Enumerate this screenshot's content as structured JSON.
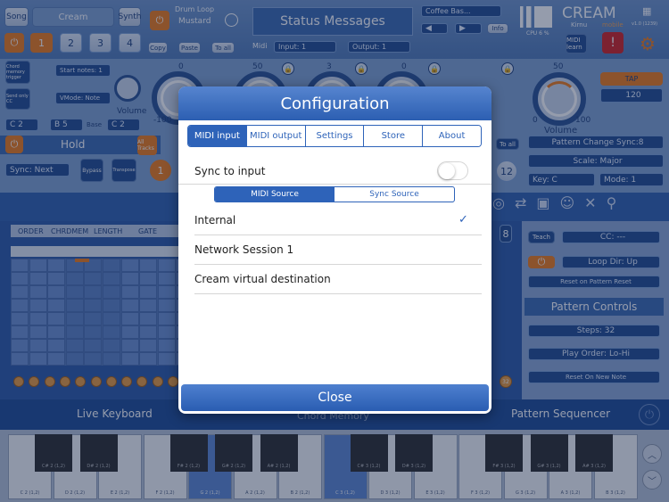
{
  "top": {
    "song": "Song",
    "preset": "Cream",
    "synth": "Synth",
    "drum_loop": "Drum Loop",
    "drum_name": "Mustard",
    "status": "Status Messages",
    "coffee": "Coffee Bas...",
    "info": "Info",
    "cpu": "CPU 6 %",
    "brand": "CREAM",
    "brand_sub": "Kirnu",
    "mobile": "mobile",
    "version": "v1.0 (1239)",
    "copy": "Copy",
    "paste": "Paste",
    "to_all": "To all",
    "midi": "Midi",
    "input": "Input: 1",
    "output": "Output: 1",
    "midi_learn": "MIDI learn",
    "slots": [
      "1",
      "2",
      "3",
      "4"
    ]
  },
  "left": {
    "chord_memory": "Chord memory trigger",
    "send_only_cc": "Send only CC",
    "start_notes": "Start notes: 1",
    "vmode": "VMode: Note",
    "volume": "Volume",
    "c2": "C 2",
    "b5": "B 5",
    "base": "Base",
    "c2b": "C 2",
    "hold": "Hold",
    "all_tracks": "All Tracks",
    "sync": "Sync: Next",
    "bypass": "Bypass",
    "transpose": "Transpose",
    "one": "1"
  },
  "knobs": {
    "k1_top": "0",
    "k1_left": "-100",
    "k2_top": "50",
    "k3_top": "3",
    "k4_top": "0",
    "vol_top": "50",
    "vol_left": "0",
    "vol_right": "100",
    "vol_label": "Volume"
  },
  "right": {
    "tap": "TAP",
    "bpm": "120",
    "to_all": "To all",
    "pattern_change": "Pattern Change Sync:8",
    "scale": "Scale: Major",
    "key": "Key: C",
    "mode": "Mode: 1",
    "twelve": "12",
    "eight": "8",
    "teach": "Teach",
    "cc": "CC: ---",
    "loop_dir": "Loop Dir: Up",
    "reset_pattern": "Reset on Pattern Reset",
    "pattern_controls": "Pattern Controls",
    "steps": "Steps: 32",
    "play_order": "Play Order: Lo-Hi",
    "reset_new_note": "Reset On New Note",
    "thirty_two": "32"
  },
  "seq_tabs": [
    "ORDER",
    "CHRDMEM",
    "LENGTH",
    "GATE"
  ],
  "bottom": {
    "live_keyboard": "Live Keyboard",
    "chord_memory": "Chord Memory",
    "pattern_sequencer": "Pattern Sequencer"
  },
  "keys": {
    "white": [
      "C 2 (1,2)",
      "D 2 (1,2)",
      "E 2 (1,2)",
      "F 2 (1,2)",
      "G 2 (1,2)",
      "A 2 (1,2)",
      "B 2 (1,2)",
      "C 3 (1,2)",
      "D 3 (1,2)",
      "E 3 (1,2)",
      "F 3 (1,2)",
      "G 3 (1,2)",
      "A 3 (1,2)",
      "B 3 (1,2)"
    ],
    "black": [
      "C# 2 (1,2)",
      "D# 2 (1,2)",
      "F# 2 (1,2)",
      "G# 2 (1,2)",
      "A# 2 (1,2)",
      "C# 3 (1,2)",
      "D# 3 (1,2)",
      "F# 3 (1,2)",
      "G# 3 (1,2)",
      "A# 3 (1,2)"
    ]
  },
  "dialog": {
    "title": "Configuration",
    "tabs": [
      "MIDI input",
      "MIDI output",
      "Settings",
      "Store",
      "About"
    ],
    "sync_to_input": "Sync to input",
    "seg": [
      "MIDI Source",
      "Sync Source"
    ],
    "sources": [
      "Internal",
      "Network Session 1",
      "Cream virtual destination"
    ],
    "check": "✓",
    "close": "Close"
  }
}
